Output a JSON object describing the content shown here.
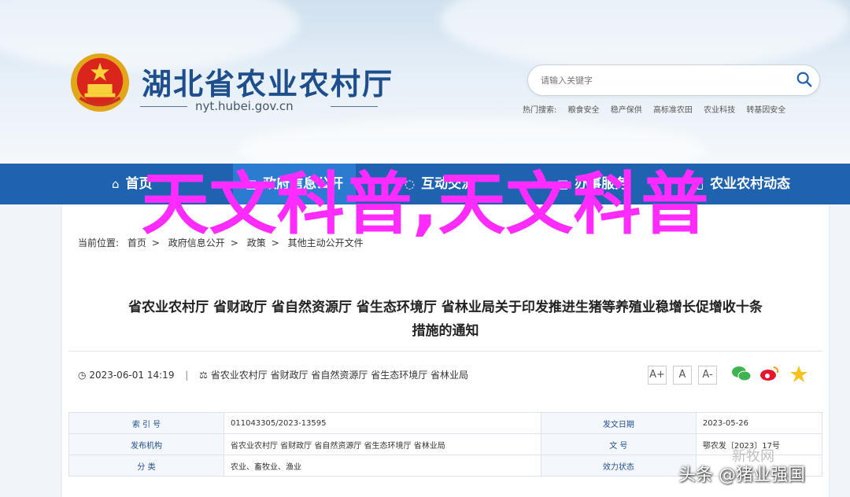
{
  "site": {
    "title": "湖北省农业农村厅",
    "domain": "nyt.hubei.gov.cn"
  },
  "search": {
    "placeholder": "请输入关键字",
    "hot_label": "热门搜索:",
    "hot_items": [
      "粮食安全",
      "稳产保供",
      "高标准农田",
      "农业科技",
      "转基因安全"
    ]
  },
  "nav": {
    "items": [
      {
        "icon": "home-icon",
        "label": "首页"
      },
      {
        "icon": "doc-icon",
        "label": "政府信息公开"
      },
      {
        "icon": "chat-icon",
        "label": "互动交流"
      },
      {
        "icon": "service-icon",
        "label": "办事服务"
      },
      {
        "icon": "news-icon",
        "label": "农业农村动态"
      }
    ]
  },
  "breadcrumb": {
    "label": "当前位置:",
    "items": [
      "首页",
      "政府信息公开",
      "政策",
      "其他主动公开文件"
    ]
  },
  "article": {
    "title_line1": "省农业农村厅 省财政厅 省自然资源厅 省生态环境厅 省林业局关于印发推进生猪等养殖业稳增长促增收十条",
    "title_line2": "措施的通知",
    "date": "2023-06-01 14:19",
    "sources": "省农业农村厅 省财政厅 省自然资源厅 省生态环境厅 省林业局",
    "font_buttons": [
      "A+",
      "A",
      "A-"
    ]
  },
  "info_table": [
    {
      "k1": "索 引 号",
      "v1": "011043305/2023-13595",
      "k2": "发文日期",
      "v2": "2023-05-26"
    },
    {
      "k1": "发布机构",
      "v1": "省农业农村厅 省财政厅 省自然资源厅 省生态环境厅 省林业局",
      "k2": "文 号",
      "v2": "鄂农发〔2023〕17号"
    },
    {
      "k1": "分 类",
      "v1": "农业、畜牧业、渔业",
      "k2": "效力状态",
      "v2": ""
    }
  ],
  "overlay_text": "天文科普,天文科普",
  "watermark": "头条 @猪业强国",
  "watermark_faint": "新牧网",
  "colors": {
    "nav_bg": "#1f63b0",
    "title_blue": "#1f4e8c",
    "overlay": "#ff2bff"
  }
}
